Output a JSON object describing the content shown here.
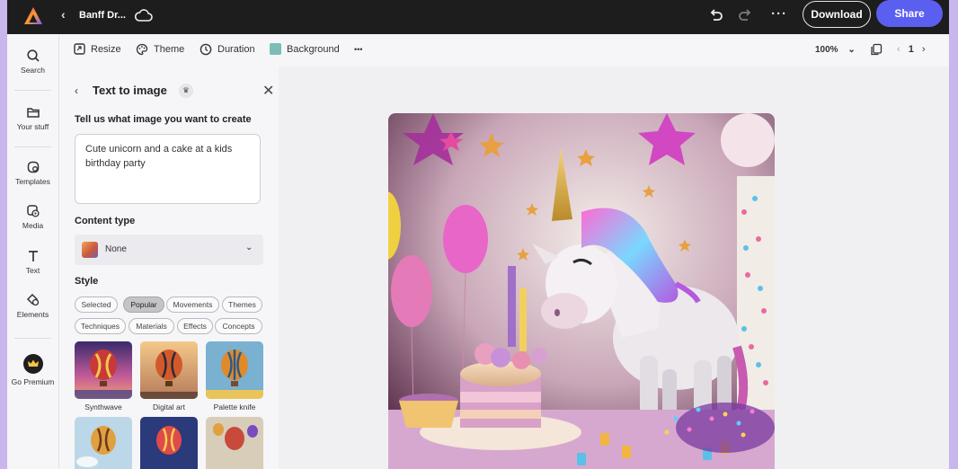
{
  "topbar": {
    "doc_title": "Banff Dr...",
    "download_label": "Download",
    "share_label": "Share"
  },
  "rail": {
    "items": [
      {
        "label": "Search"
      },
      {
        "label": "Your stuff"
      },
      {
        "label": "Templates"
      },
      {
        "label": "Media"
      },
      {
        "label": "Text"
      },
      {
        "label": "Elements"
      },
      {
        "label": "Go Premium"
      }
    ]
  },
  "toolbar": {
    "resize": "Resize",
    "theme": "Theme",
    "duration": "Duration",
    "background": "Background",
    "background_color": "#7cbcb7",
    "more": "•••",
    "zoom": "100%",
    "page_number": "1"
  },
  "panel": {
    "title": "Text to image",
    "prompt_heading": "Tell us what image you want to create",
    "prompt_value": "Cute unicorn and a cake at a kids birthday party",
    "content_type_heading": "Content type",
    "content_type_value": "None",
    "style_heading": "Style",
    "style_tabs": [
      "Selected",
      "Popular",
      "Movements",
      "Themes",
      "Techniques",
      "Materials",
      "Effects",
      "Concepts"
    ],
    "active_style_tab": "Popular",
    "style_thumbs": [
      {
        "caption": "Synthwave"
      },
      {
        "caption": "Digital art"
      },
      {
        "caption": "Palette knife"
      }
    ]
  },
  "colors": {
    "accent": "#5b5ff0",
    "topbar": "#1d1d1d",
    "frame": "#c9b6ec"
  }
}
